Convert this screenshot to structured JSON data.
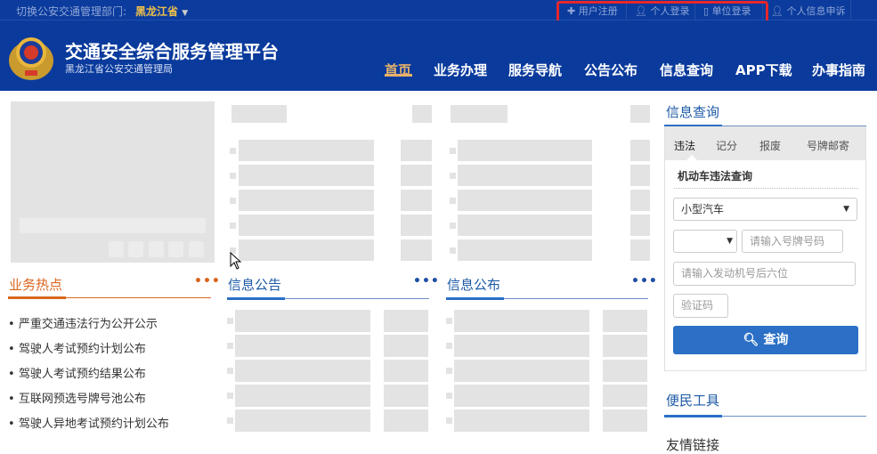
{
  "topbar": {
    "switch_label": "切换公安交通管理部门:",
    "province": "黑龙江省",
    "links": [
      {
        "label": "用户注册",
        "icon": "plus-icon"
      },
      {
        "label": "个人登录",
        "icon": "user-icon"
      },
      {
        "label": "单位登录",
        "icon": "building-icon"
      },
      {
        "label": "个人信息申诉",
        "icon": "user-icon"
      }
    ]
  },
  "header": {
    "title": "交通安全综合服务管理平台",
    "subtitle": "黑龙江省公安交通管理局",
    "nav": [
      "首页",
      "业务办理",
      "服务导航",
      "公告公布",
      "信息查询",
      "APP下载",
      "办事指南"
    ],
    "active_nav": "首页"
  },
  "sections": {
    "hot": {
      "title": "业务热点",
      "more": "•••",
      "items": [
        "严重交通违法行为公开公示",
        "驾驶人考试预约计划公布",
        "驾驶人考试预约结果公布",
        "互联网预选号牌号池公布",
        "驾驶人异地考试预约计划公布"
      ]
    },
    "notice": {
      "title": "信息公告",
      "more": "•••"
    },
    "publish": {
      "title": "信息公布",
      "more": "•••"
    }
  },
  "query": {
    "title": "信息查询",
    "tabs": [
      "违法",
      "记分",
      "报废",
      "号牌邮寄"
    ],
    "active_tab": "违法",
    "subtitle": "机动车违法查询",
    "vehicle_type": "小型汽车",
    "plate_prefix": "",
    "plate_placeholder": "请输入号牌号码",
    "engine_placeholder": "请输入发动机号后六位",
    "captcha_placeholder": "验证码",
    "button": "查询"
  },
  "tools": {
    "title": "便民工具"
  },
  "links": {
    "title": "友情链接"
  },
  "colors": {
    "header_bg": "#0a3a9c",
    "accent_orange": "#d9661e",
    "accent_blue": "#1d5aa6",
    "button": "#2b6fc6",
    "highlight": "#e5272b"
  }
}
